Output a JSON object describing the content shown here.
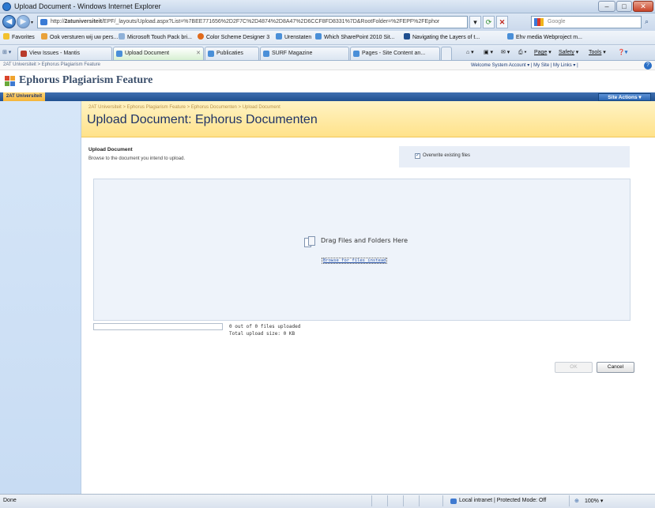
{
  "window": {
    "title": "Upload Document - Windows Internet Explorer",
    "controls": {
      "minimize": "–",
      "maximize": "□",
      "close": "✕"
    }
  },
  "address_bar": {
    "url_prefix": "http://",
    "url_host": "2atuniversiteit",
    "url_rest": "/EPF/_layouts/Upload.aspx?List=%7BEE771656%2D2F7C%2D4874%2D8A47%2D6CCF8FD8331%7D&RootFolder=%2FEPF%2FEphor",
    "search_placeholder": "Google"
  },
  "favorites_bar": {
    "favorites_label": "Favorites",
    "items": [
      "Ook versturen wij uw pers...",
      "Microsoft Touch Pack bri...",
      "Color Scheme Designer 3",
      "Urenstaten",
      "Which SharePoint 2010 Sit...",
      "Navigating the Layers of t...",
      "Ehv media Webproject m..."
    ]
  },
  "tabs": [
    {
      "label": "View Issues - Mantis"
    },
    {
      "label": "Upload Document",
      "active": true
    },
    {
      "label": "Publicaties"
    },
    {
      "label": "SURF Magazine"
    },
    {
      "label": "Pages - Site Content an..."
    }
  ],
  "command_bar": {
    "page": "Page",
    "safety": "Safety",
    "tools": "Tools"
  },
  "sharepoint": {
    "top_breadcrumb": "2AT Universiteit > Ephorus Plagiarism Feature",
    "welcome": "Welcome System Account ▾  |  My Site  |  My Links ▾  |",
    "site_title": "Ephorus Plagiarism Feature",
    "nav_home": "2AT Universiteit",
    "site_actions": "Site Actions ▾"
  },
  "page": {
    "breadcrumb": "2AT Universiteit > Ephorus Plagiarism Feature > Ephorus Documenten > Upload Document",
    "title": "Upload Document: Ephorus Documenten"
  },
  "upload": {
    "heading": "Upload Document",
    "description": "Browse to the document you intend to upload.",
    "overwrite_label": "Overwrite existing files",
    "overwrite_checked": true,
    "drop_text": "Drag Files and Folders Here",
    "browse_link": "Browse for files instead",
    "progress_line1": "0 out of 0 files uploaded",
    "progress_line2": "Total upload size: 0 KB",
    "ok_label": "OK",
    "cancel_label": "Cancel"
  },
  "status_bar": {
    "status": "Done",
    "zone": "Local intranet | Protected Mode: Off",
    "zoom": "100%"
  }
}
